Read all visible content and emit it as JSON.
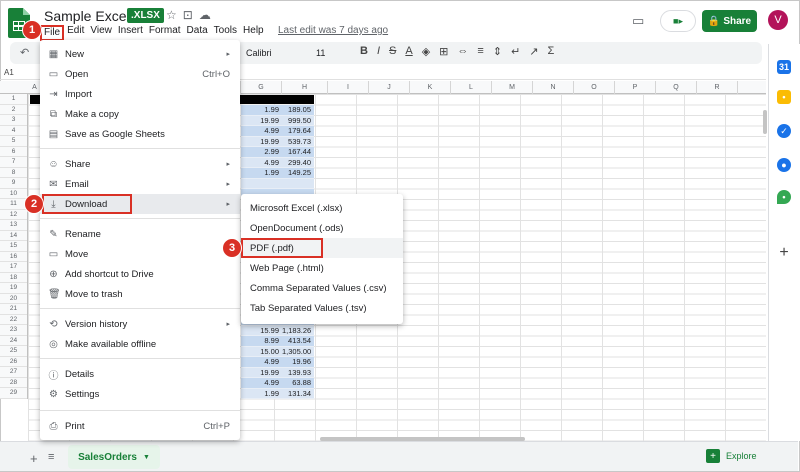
{
  "header": {
    "doc_title": "Sample Excel-1",
    "format_badge": ".XLSX",
    "menu": [
      "File",
      "Edit",
      "View",
      "Insert",
      "Format",
      "Data",
      "Tools",
      "Help"
    ],
    "last_edit": "Last edit was 7 days ago",
    "share_label": "Share",
    "avatar_initial": "V"
  },
  "toolbar": {
    "font": "Calibri",
    "font_size": "11"
  },
  "formula_bar": {
    "cell_ref": "A1"
  },
  "grid": {
    "columns": [
      "A",
      "B",
      "C",
      "D",
      "E",
      "F",
      "G",
      "H",
      "I",
      "J",
      "K",
      "L",
      "M",
      "N",
      "O",
      "P",
      "Q",
      "R"
    ],
    "rows": [
      "1",
      "2",
      "3",
      "4",
      "5",
      "6",
      "7",
      "8",
      "9",
      "10",
      "11",
      "12",
      "13",
      "14",
      "15",
      "16",
      "17",
      "18",
      "19",
      "20",
      "21",
      "22",
      "23",
      "24",
      "25",
      "26",
      "27",
      "28",
      "29"
    ],
    "col_f": [
      "1.99",
      "19.99",
      "4.99",
      "19.99",
      "2.99",
      "4.99",
      "1.99",
      "",
      "",
      "",
      "",
      "",
      "",
      "",
      "",
      "",
      "",
      "",
      "19.99",
      "4.99",
      "1.29",
      "15.99",
      "8.99",
      "15.00",
      "4.99",
      "19.99",
      "4.99",
      "1.99"
    ],
    "col_g": [
      "189.05",
      "999.50",
      "179.64",
      "539.73",
      "167.44",
      "299.40",
      "149.25",
      "",
      "",
      "",
      "",
      "",
      "",
      "",
      "",
      "",
      "",
      "",
      "299.85",
      "479.04",
      "86.43",
      "1,183.26",
      "413.54",
      "1,305.00",
      "19.96",
      "139.93",
      "63.88",
      "131.34"
    ]
  },
  "file_menu": {
    "items": [
      {
        "icon": "new-icon",
        "glyph": "▦",
        "label": "New",
        "shortcut": "",
        "arrow": "▸"
      },
      {
        "icon": "open-icon",
        "glyph": "▭",
        "label": "Open",
        "shortcut": "Ctrl+O",
        "arrow": ""
      },
      {
        "icon": "import-icon",
        "glyph": "⇥",
        "label": "Import",
        "shortcut": "",
        "arrow": ""
      },
      {
        "icon": "copy-icon",
        "glyph": "⧉",
        "label": "Make a copy",
        "shortcut": "",
        "arrow": ""
      },
      {
        "icon": "save-sheets-icon",
        "glyph": "▤",
        "label": "Save as Google Sheets",
        "shortcut": "",
        "arrow": ""
      },
      {
        "icon": "share-icon",
        "glyph": "☺",
        "label": "Share",
        "shortcut": "",
        "arrow": "▸"
      },
      {
        "icon": "email-icon",
        "glyph": "✉",
        "label": "Email",
        "shortcut": "",
        "arrow": "▸"
      },
      {
        "icon": "download-icon",
        "glyph": "⤓",
        "label": "Download",
        "shortcut": "",
        "arrow": "▸"
      },
      {
        "icon": "rename-icon",
        "glyph": "✎",
        "label": "Rename",
        "shortcut": "",
        "arrow": ""
      },
      {
        "icon": "move-icon",
        "glyph": "▭",
        "label": "Move",
        "shortcut": "",
        "arrow": ""
      },
      {
        "icon": "shortcut-icon",
        "glyph": "⊕",
        "label": "Add shortcut to Drive",
        "shortcut": "",
        "arrow": ""
      },
      {
        "icon": "trash-icon",
        "glyph": "🗑",
        "label": "Move to trash",
        "shortcut": "",
        "arrow": ""
      },
      {
        "icon": "history-icon",
        "glyph": "⟲",
        "label": "Version history",
        "shortcut": "",
        "arrow": "▸"
      },
      {
        "icon": "offline-icon",
        "glyph": "◎",
        "label": "Make available offline",
        "shortcut": "",
        "arrow": ""
      },
      {
        "icon": "details-icon",
        "glyph": "ⓘ",
        "label": "Details",
        "shortcut": "",
        "arrow": ""
      },
      {
        "icon": "settings-icon",
        "glyph": "⚙",
        "label": "Settings",
        "shortcut": "",
        "arrow": ""
      },
      {
        "icon": "print-icon",
        "glyph": "⎙",
        "label": "Print",
        "shortcut": "Ctrl+P",
        "arrow": ""
      }
    ]
  },
  "download_menu": {
    "items": [
      "Microsoft Excel (.xlsx)",
      "OpenDocument (.ods)",
      "PDF (.pdf)",
      "Web Page (.html)",
      "Comma Separated Values (.csv)",
      "Tab Separated Values (.tsv)"
    ]
  },
  "steps": [
    "1",
    "2",
    "3"
  ],
  "bottom": {
    "sheet_tab": "SalesOrders",
    "explore": "Explore"
  },
  "colors": {
    "brand_green": "#188038",
    "highlight_red": "#d93025",
    "selection_blue": "#c6d9f0"
  }
}
